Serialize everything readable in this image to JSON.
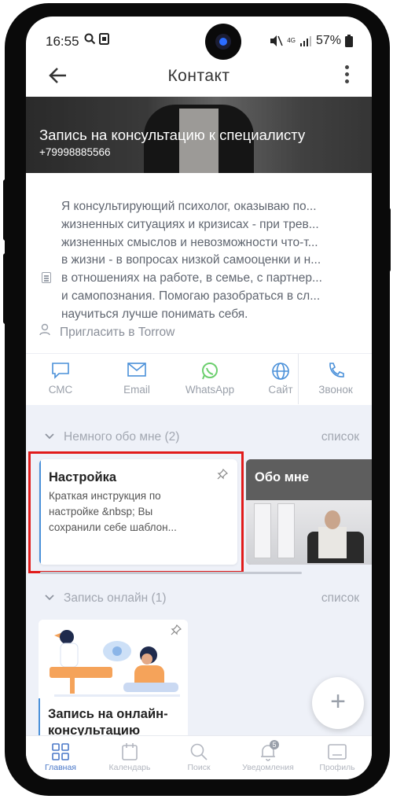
{
  "status_bar": {
    "time": "16:55",
    "battery": "57%",
    "network": "4G"
  },
  "app_bar": {
    "title": "Контакт"
  },
  "hero": {
    "title": "Запись на консультацию к специалисту",
    "phone": "+79998885566"
  },
  "description_lines": [
    "Я консультирующий психолог, оказываю по...",
    "жизненных ситуациях и кризисах - при трев...",
    "жизненных смыслов и невозможности что-т...",
    "в жизни - в вопросах низкой самооценки и н...",
    "в отношениях на работе, в семье, с партнер...",
    "и самопознания. Помогаю разобраться в сл...",
    "научиться лучше понимать себя."
  ],
  "invite": "Пригласить в Torrow",
  "actions": [
    {
      "label": "СМС",
      "icon": "sms-icon"
    },
    {
      "label": "Email",
      "icon": "email-icon"
    },
    {
      "label": "WhatsApp",
      "icon": "whatsapp-icon"
    },
    {
      "label": "Сайт",
      "icon": "globe-icon"
    },
    {
      "label": "Звонок",
      "icon": "phone-icon"
    }
  ],
  "section1": {
    "name": "Немного обо мне (2)",
    "view": "список"
  },
  "card_settings": {
    "title": "Настройка",
    "body": "Краткая инструкция по настройке &nbsp; Вы сохранили себе шаблон..."
  },
  "card_about": {
    "title": "Обо мне"
  },
  "section2": {
    "name": "Запись онлайн (1)",
    "view": "список"
  },
  "card_online": {
    "title": "Запись на онлайн-консультацию"
  },
  "fab": "+",
  "nav": [
    {
      "label": "Главная",
      "icon": "grid-icon"
    },
    {
      "label": "Календарь",
      "icon": "calendar-icon"
    },
    {
      "label": "Поиск",
      "icon": "search-icon"
    },
    {
      "label": "Уведомления",
      "icon": "bell-icon",
      "badge": "5"
    },
    {
      "label": "Профиль",
      "icon": "profile-icon"
    }
  ],
  "colors": {
    "accent": "#4a90d9",
    "highlight": "#e11b1b",
    "section_bg": "#eef1f8",
    "whatsapp": "#6ccf6e"
  }
}
